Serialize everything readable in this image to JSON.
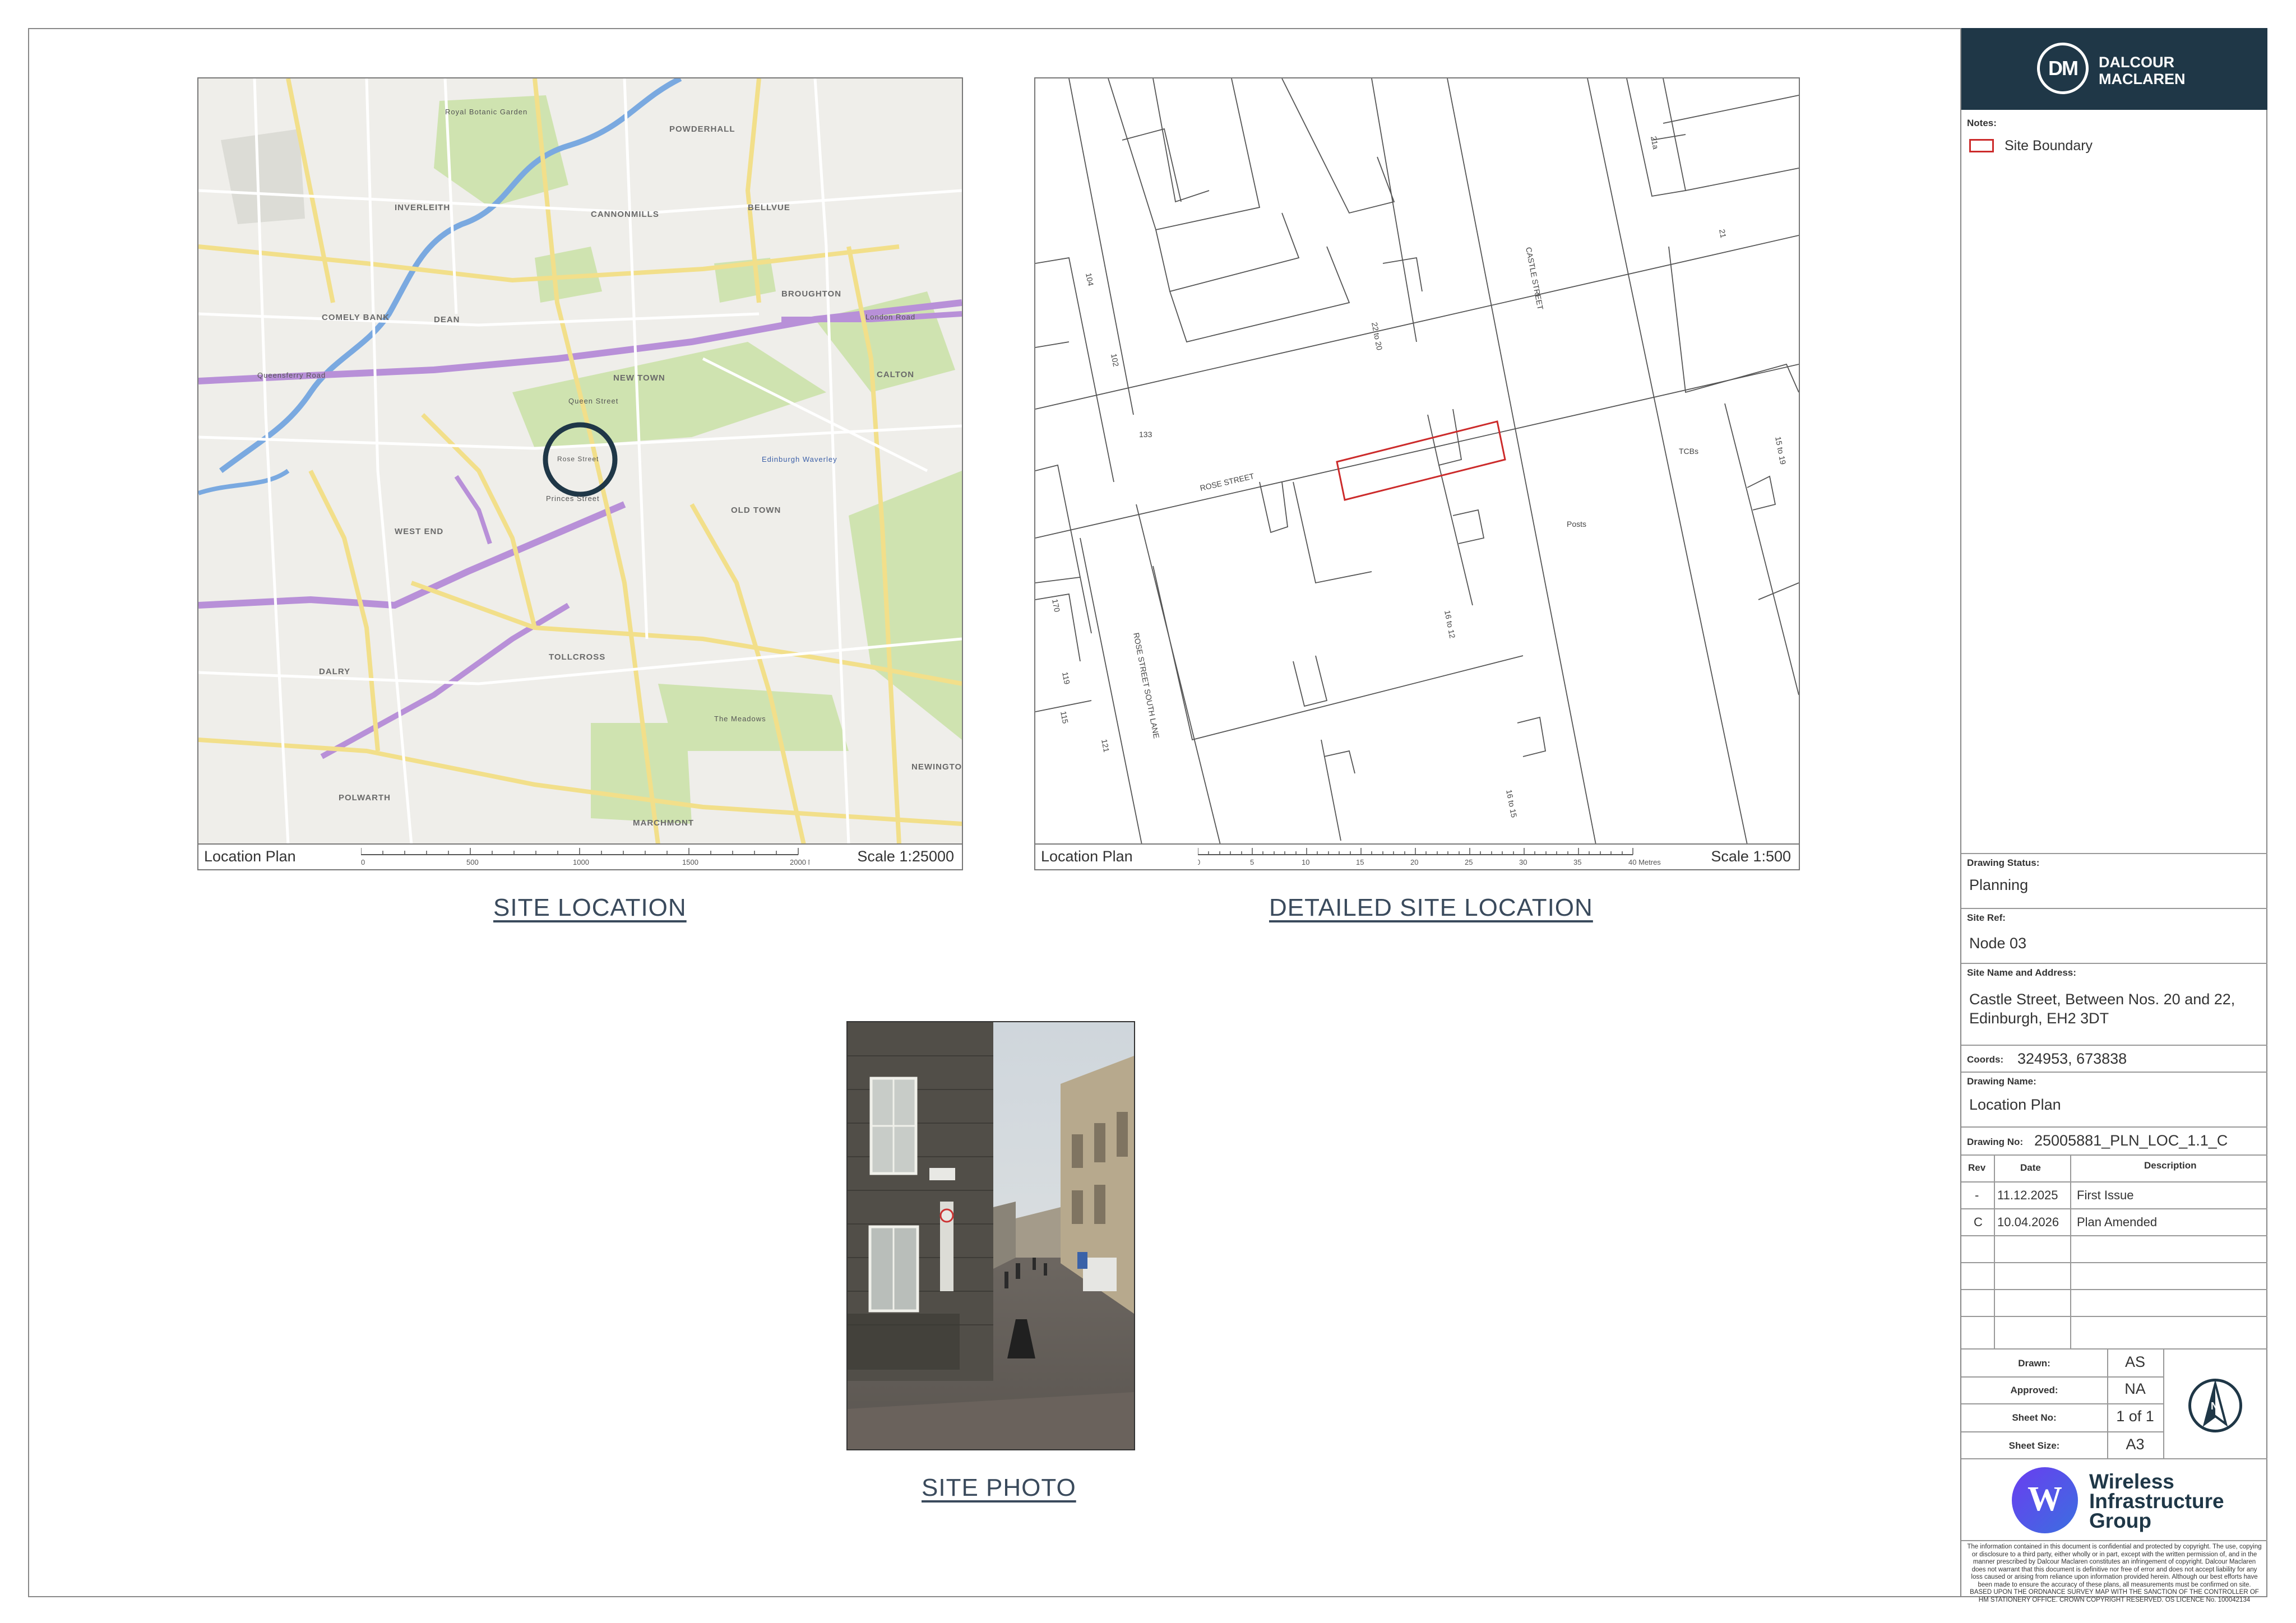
{
  "panels": {
    "site_location": {
      "footer_label": "Location Plan",
      "scale_label": "Scale 1:25000",
      "caption": "SITE LOCATION",
      "scale_ticks": [
        "0",
        "500",
        "1000",
        "1500",
        "2000 Metres"
      ],
      "map_labels": [
        "POWDERHALL",
        "INVERLEITH",
        "CANNONMILLS",
        "BELLVUE",
        "BROUGHTON",
        "COMELY BANK",
        "DEAN",
        "NEW TOWN",
        "CALTON",
        "WEST END",
        "OLD TOWN",
        "DALRY",
        "TOLLCROSS",
        "POLWARTH",
        "MARCHMONT",
        "NEWINGTON",
        "Queen Street",
        "Princes Street",
        "Rose Street",
        "The Meadows",
        "Edinburgh Waverley",
        "Queensferry Road",
        "London Road",
        "Royal Botanic Garden"
      ]
    },
    "detailed_site_location": {
      "footer_label": "Location Plan",
      "scale_label": "Scale 1:500",
      "caption": "DETAILED SITE LOCATION",
      "scale_ticks": [
        "0",
        "5",
        "10",
        "15",
        "20",
        "25",
        "30",
        "35",
        "40 Metres"
      ],
      "plan_labels": [
        "ROSE STREET",
        "CASTLE STREET",
        "ROSE STREET SOUTH LANE",
        "TCBs",
        "Posts",
        "133",
        "104",
        "102",
        "22 to 20",
        "21",
        "21a",
        "15 to 19",
        "170",
        "119",
        "115",
        "121",
        "16 to 12",
        "16 to 15"
      ]
    },
    "site_photo": {
      "caption": "SITE PHOTO"
    }
  },
  "title_block": {
    "company": {
      "line1": "DALCOUR",
      "line2": "MACLAREN",
      "monogram": "DM"
    },
    "notes_label": "Notes:",
    "legend_site_boundary": "Site Boundary",
    "drawing_status_label": "Drawing Status:",
    "drawing_status": "Planning",
    "site_ref_label": "Site Ref:",
    "site_ref": "Node 03",
    "site_name_label": "Site Name and Address:",
    "site_name_line1": "Castle Street, Between Nos. 20 and 22,",
    "site_name_line2": "Edinburgh, EH2 3DT",
    "coords_label": "Coords:",
    "coords": "324953, 673838",
    "drawing_name_label": "Drawing Name:",
    "drawing_name": "Location Plan",
    "drawing_no_label": "Drawing No:",
    "drawing_no": "25005881_PLN_LOC_1.1_C",
    "rev_headers": {
      "rev": "Rev",
      "date": "Date",
      "description": "Description"
    },
    "revisions": [
      {
        "rev": "-",
        "date": "11.12.2025",
        "description": "First Issue"
      },
      {
        "rev": "C",
        "date": "10.04.2026",
        "description": "Plan Amended"
      }
    ],
    "drawn_label": "Drawn:",
    "drawn": "AS",
    "approved_label": "Approved:",
    "approved": "NA",
    "sheet_no_label": "Sheet No:",
    "sheet_no": "1 of 1",
    "sheet_size_label": "Sheet Size:",
    "sheet_size": "A3",
    "north_letter": "N",
    "client": {
      "line1": "Wireless",
      "line2": "Infrastructure",
      "line3": "Group"
    },
    "disclaimer": "The information contained in this document is confidential and protected by copyright. The use, copying or disclosure to a third party, either wholly or in part, except with the written permission of, and in the manner prescribed by Dalcour Maclaren constitutes an infringement of copyright. Dalcour Maclaren does not warrant that this document is definitive nor free of error and does not accept liability for any loss caused or arising from reliance upon information provided herein. Although our best efforts have been made to ensure the accuracy of these plans, all measurements must be confirmed on site. BASED UPON THE ORDNANCE SURVEY MAP WITH THE SANCTION OF THE CONTROLLER OF HM STATIONERY OFFICE. CROWN COPYRIGHT RESERVED. OS LICENCE No. 100042134"
  },
  "colors": {
    "title_bar": "#1f3747",
    "site_boundary": "#cc2b2b",
    "caption": "#3a4a5c",
    "client_gradient_start": "#6a3df0",
    "client_gradient_end": "#3b6fe0"
  }
}
